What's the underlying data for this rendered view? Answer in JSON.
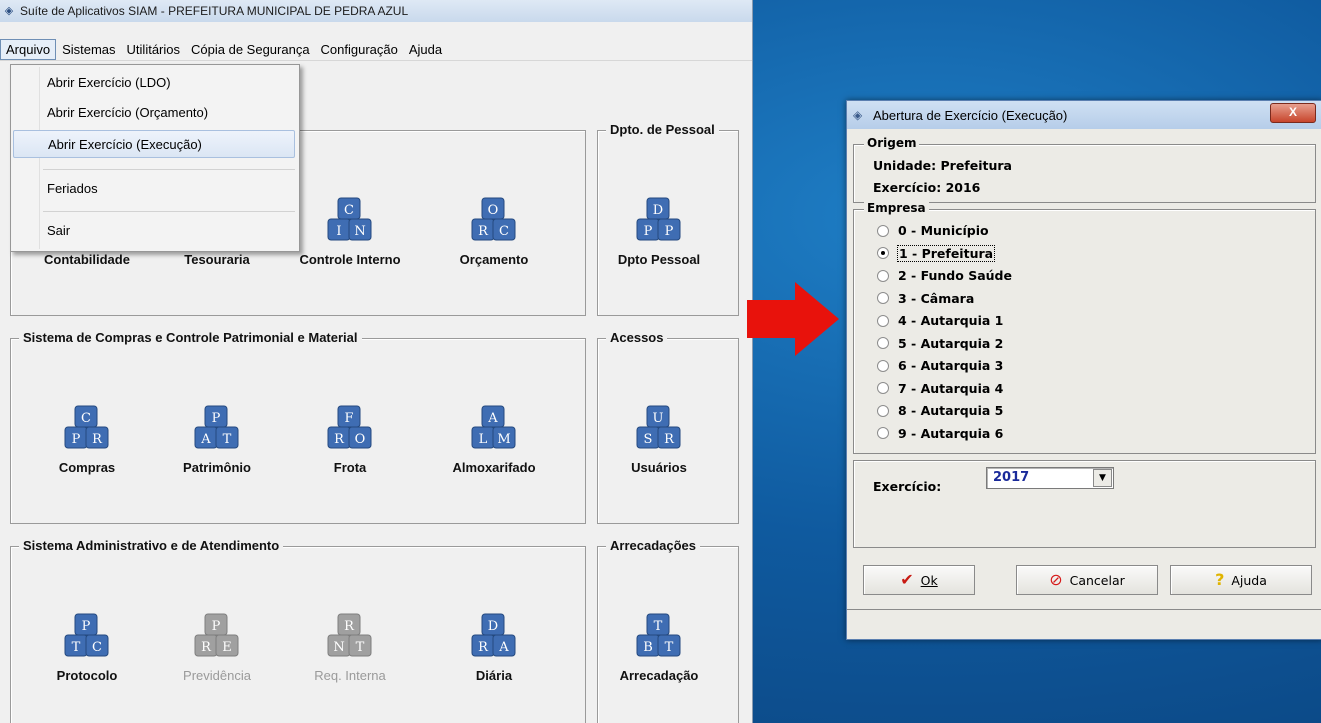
{
  "main_window": {
    "title": "Suíte de Aplicativos SIAM - PREFEITURA MUNICIPAL DE PEDRA AZUL",
    "menu": [
      "Arquivo",
      "Sistemas",
      "Utilitários",
      "Cópia de Segurança",
      "Configuração",
      "Ajuda"
    ],
    "arquivo_menu": {
      "items": [
        "Abrir Exercício (LDO)",
        "Abrir Exercício (Orçamento)",
        "Abrir Exercício (Execução)",
        "Feriados",
        "Sair"
      ],
      "highlighted": "Abrir Exercício (Execução)"
    },
    "groups": {
      "dpto_pessoal": "Dpto. de Pessoal",
      "compras": "Sistema de Compras e Controle Patrimonial e Material",
      "acessos": "Acessos",
      "administrativo": "Sistema Administrativo e de Atendimento",
      "arrecadacoes": "Arrecadações"
    },
    "modules": [
      {
        "label": "Contabilidade",
        "letters": [],
        "enabled": true
      },
      {
        "label": "Tesouraria",
        "letters": [],
        "enabled": true
      },
      {
        "label": "Controle Interno",
        "letters": [
          "C",
          "I",
          "N"
        ],
        "enabled": true
      },
      {
        "label": "Orçamento",
        "letters": [
          "O",
          "R",
          "C"
        ],
        "enabled": true
      },
      {
        "label": "Dpto Pessoal",
        "letters": [
          "D",
          "P",
          "P"
        ],
        "enabled": true
      },
      {
        "label": "Compras",
        "letters": [
          "C",
          "P",
          "R"
        ],
        "enabled": true
      },
      {
        "label": "Patrimônio",
        "letters": [
          "P",
          "A",
          "T"
        ],
        "enabled": true
      },
      {
        "label": "Frota",
        "letters": [
          "F",
          "R",
          "O"
        ],
        "enabled": true
      },
      {
        "label": "Almoxarifado",
        "letters": [
          "A",
          "L",
          "M"
        ],
        "enabled": true
      },
      {
        "label": "Usuários",
        "letters": [
          "U",
          "S",
          "R"
        ],
        "enabled": true
      },
      {
        "label": "Protocolo",
        "letters": [
          "P",
          "T",
          "C"
        ],
        "enabled": true
      },
      {
        "label": "Previdência",
        "letters": [
          "P",
          "R",
          "E"
        ],
        "enabled": false
      },
      {
        "label": "Req. Interna",
        "letters": [
          "R",
          "N",
          "T"
        ],
        "enabled": false
      },
      {
        "label": "Diária",
        "letters": [
          "D",
          "R",
          "A"
        ],
        "enabled": true
      },
      {
        "label": "Arrecadação",
        "letters": [
          "T",
          "B",
          "T"
        ],
        "enabled": true
      }
    ]
  },
  "dialog": {
    "title": "Abertura de Exercício (Execução)",
    "close": "X",
    "origem": {
      "title": "Origem",
      "unidade": "Unidade: Prefeitura",
      "exercicio": "Exercício: 2016"
    },
    "empresa": {
      "title": "Empresa",
      "options": [
        "0 - Município",
        "1 - Prefeitura",
        "2 - Fundo Saúde",
        "3 - Câmara",
        "4 - Autarquia 1",
        "5 - Autarquia 2",
        "6 - Autarquia 3",
        "7 - Autarquia 4",
        "8 - Autarquia 5",
        "9 - Autarquia 6"
      ],
      "selected": "1 - Prefeitura"
    },
    "exercicio_label": "Exercício:",
    "exercicio_value": "2017",
    "buttons": {
      "ok": "Ok",
      "cancel": "Cancelar",
      "help": "Ajuda"
    }
  },
  "colors": {
    "icon_blue": "#3f6db3",
    "icon_disabled": "#a0a0a0",
    "arrow_red": "#e8120c"
  }
}
